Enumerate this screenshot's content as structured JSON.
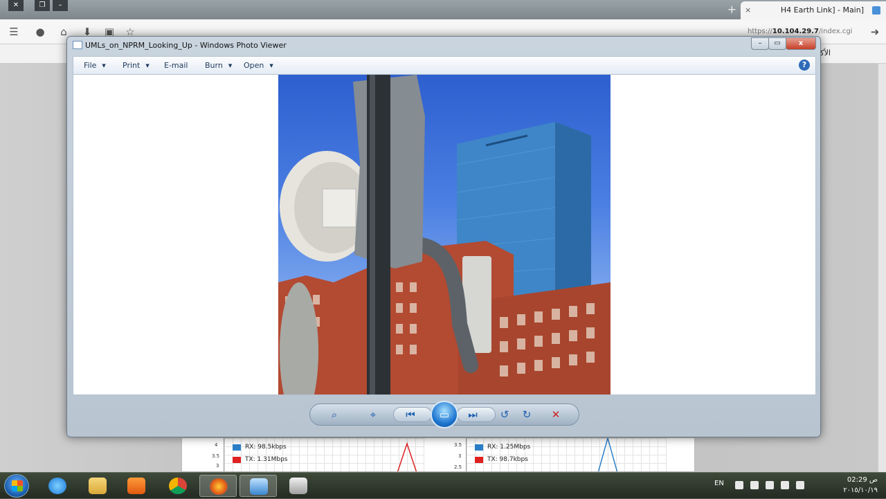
{
  "browser": {
    "tab_label": "H4 Earth Link] - Main]",
    "url_prefix": "https://",
    "url_host": "10.104.29.7",
    "url_path": "/index.cgi",
    "bookmark_label": "الأكثر زيارة"
  },
  "graphs": [
    {
      "ticks": [
        "4",
        "3.5",
        "3"
      ],
      "rx": "RX: 98.5kbps",
      "tx": "TX: 1.31Mbps"
    },
    {
      "ticks": [
        "3.5",
        "3",
        "2.5"
      ],
      "rx": "RX: 1.25Mbps",
      "tx": "TX: 98.7kbps"
    }
  ],
  "viewer": {
    "title": "UMLs_on_NPRM_Looking_Up - Windows Photo Viewer",
    "menu": [
      {
        "label": "File",
        "has_caret": true
      },
      {
        "label": "Print",
        "has_caret": true
      },
      {
        "label": "E-mail",
        "has_caret": false
      },
      {
        "label": "Burn",
        "has_caret": true
      },
      {
        "label": "Open",
        "has_caret": true
      }
    ],
    "help_label": "?",
    "window_controls": {
      "minimize": "–",
      "maximize": "▭",
      "close": "x"
    }
  },
  "controls": {
    "zoom": "⌕",
    "actual_size": "⌖",
    "previous": "⏮",
    "slideshow": "▭",
    "next": "⏭",
    "rotate_ccw": "↺",
    "rotate_cw": "↻",
    "delete": "✕"
  },
  "taskbar": {
    "lang": "EN",
    "time": "02:29 ص",
    "date": "٢٠١٥/١٠/١٩"
  },
  "colors": {
    "rx": "#2a7fc8",
    "tx": "#e02020",
    "accent": "#1f5fb0"
  }
}
